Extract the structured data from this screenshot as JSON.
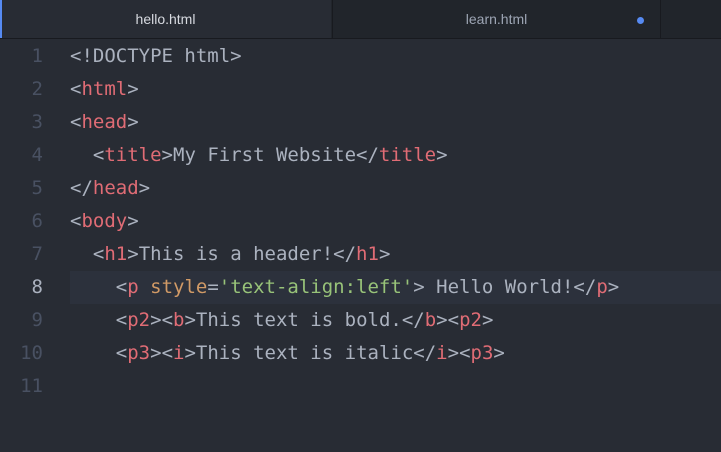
{
  "tabs": [
    {
      "label": "hello.html",
      "active": true,
      "modified": false
    },
    {
      "label": "learn.html",
      "active": false,
      "modified": true
    }
  ],
  "editor": {
    "current_line": 8,
    "lines": [
      {
        "num": "1",
        "tokens": [
          {
            "k": "p",
            "v": "<!DOCTYPE html>"
          }
        ]
      },
      {
        "num": "2",
        "tokens": [
          {
            "k": "p",
            "v": "<"
          },
          {
            "k": "t",
            "v": "html"
          },
          {
            "k": "p",
            "v": ">"
          }
        ]
      },
      {
        "num": "3",
        "tokens": [
          {
            "k": "p",
            "v": "<"
          },
          {
            "k": "t",
            "v": "head"
          },
          {
            "k": "p",
            "v": ">"
          }
        ]
      },
      {
        "num": "4",
        "tokens": [
          {
            "k": "x",
            "v": "  "
          },
          {
            "k": "p",
            "v": "<"
          },
          {
            "k": "t",
            "v": "title"
          },
          {
            "k": "p",
            "v": ">"
          },
          {
            "k": "x",
            "v": "My First Website"
          },
          {
            "k": "p",
            "v": "</"
          },
          {
            "k": "t",
            "v": "title"
          },
          {
            "k": "p",
            "v": ">"
          }
        ]
      },
      {
        "num": "5",
        "tokens": [
          {
            "k": "p",
            "v": "</"
          },
          {
            "k": "t",
            "v": "head"
          },
          {
            "k": "p",
            "v": ">"
          }
        ]
      },
      {
        "num": "6",
        "tokens": [
          {
            "k": "p",
            "v": "<"
          },
          {
            "k": "t",
            "v": "body"
          },
          {
            "k": "p",
            "v": ">"
          }
        ]
      },
      {
        "num": "7",
        "tokens": [
          {
            "k": "x",
            "v": "  "
          },
          {
            "k": "p",
            "v": "<"
          },
          {
            "k": "t",
            "v": "h1"
          },
          {
            "k": "p",
            "v": ">"
          },
          {
            "k": "x",
            "v": "This is a header!"
          },
          {
            "k": "p",
            "v": "</"
          },
          {
            "k": "t",
            "v": "h1"
          },
          {
            "k": "p",
            "v": ">"
          }
        ]
      },
      {
        "num": "8",
        "tokens": [
          {
            "k": "x",
            "v": "    "
          },
          {
            "k": "p",
            "v": "<"
          },
          {
            "k": "t",
            "v": "p"
          },
          {
            "k": "x",
            "v": " "
          },
          {
            "k": "a",
            "v": "style"
          },
          {
            "k": "p",
            "v": "="
          },
          {
            "k": "s",
            "v": "'text-align:left'"
          },
          {
            "k": "p",
            "v": ">"
          },
          {
            "k": "x",
            "v": " Hello World!"
          },
          {
            "k": "p",
            "v": "</"
          },
          {
            "k": "t",
            "v": "p"
          },
          {
            "k": "p",
            "v": ">"
          }
        ]
      },
      {
        "num": "9",
        "tokens": [
          {
            "k": "x",
            "v": "    "
          },
          {
            "k": "p",
            "v": "<"
          },
          {
            "k": "t",
            "v": "p2"
          },
          {
            "k": "p",
            "v": ">"
          },
          {
            "k": "p",
            "v": "<"
          },
          {
            "k": "t",
            "v": "b"
          },
          {
            "k": "p",
            "v": ">"
          },
          {
            "k": "x",
            "v": "This text is bold."
          },
          {
            "k": "p",
            "v": "</"
          },
          {
            "k": "t",
            "v": "b"
          },
          {
            "k": "p",
            "v": ">"
          },
          {
            "k": "p",
            "v": "<"
          },
          {
            "k": "t",
            "v": "p2"
          },
          {
            "k": "p",
            "v": ">"
          }
        ]
      },
      {
        "num": "10",
        "tokens": [
          {
            "k": "x",
            "v": "    "
          },
          {
            "k": "p",
            "v": "<"
          },
          {
            "k": "t",
            "v": "p3"
          },
          {
            "k": "p",
            "v": ">"
          },
          {
            "k": "p",
            "v": "<"
          },
          {
            "k": "t",
            "v": "i"
          },
          {
            "k": "p",
            "v": ">"
          },
          {
            "k": "x",
            "v": "This text is italic"
          },
          {
            "k": "p",
            "v": "</"
          },
          {
            "k": "t",
            "v": "i"
          },
          {
            "k": "p",
            "v": ">"
          },
          {
            "k": "p",
            "v": "<"
          },
          {
            "k": "t",
            "v": "p3"
          },
          {
            "k": "p",
            "v": ">"
          }
        ]
      },
      {
        "num": "11",
        "tokens": []
      }
    ]
  },
  "colors": {
    "background": "#282c34",
    "tab_bar": "#21252b",
    "accent": "#568af2",
    "tag": "#e06c75",
    "attribute": "#d19a66",
    "string": "#98c379",
    "text": "#abb2bf",
    "gutter": "#495162",
    "cursor_line": "#2c313c"
  }
}
